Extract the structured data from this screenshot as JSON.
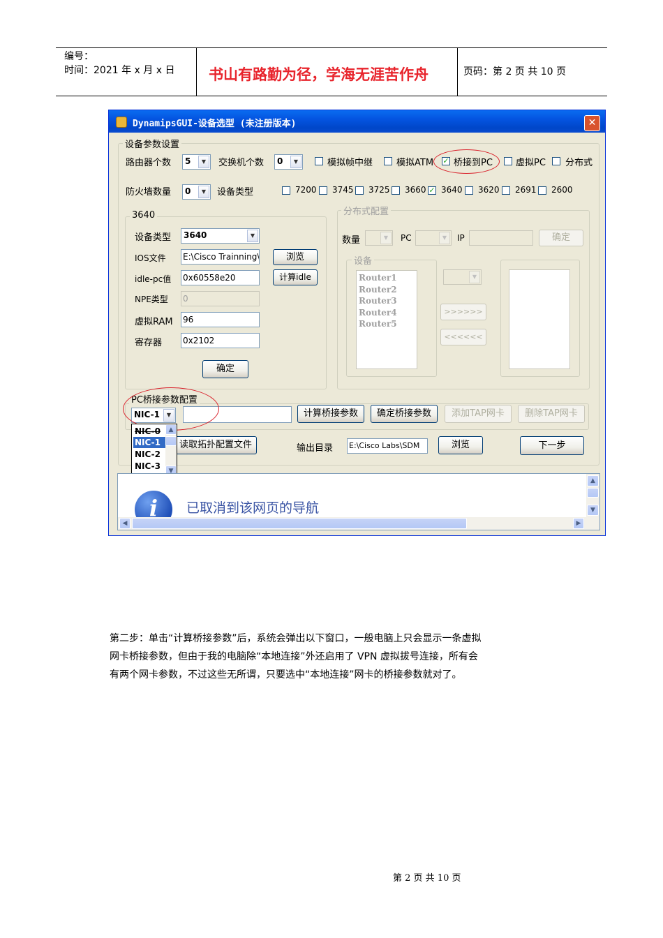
{
  "header": {
    "number_label": "编号：",
    "time_label": "时间：2021 年 x 月 x 日",
    "motto": "书山有路勤为径，学海无涯苦作舟",
    "page_label": "页码：第 2 页  共 10 页"
  },
  "window": {
    "title": "DynamipsGUI-设备选型 (未注册版本)",
    "close_glyph": "✕",
    "device_params": {
      "legend": "设备参数设置",
      "router_count_label": "路由器个数",
      "router_count_value": "5",
      "switch_count_label": "交换机个数",
      "switch_count_value": "0",
      "options": [
        {
          "label": "模拟帧中继",
          "checked": false
        },
        {
          "label": "模拟ATM",
          "checked": false
        },
        {
          "label": "桥接到PC",
          "checked": true
        },
        {
          "label": "虚拟PC",
          "checked": false
        },
        {
          "label": "分布式",
          "checked": false
        }
      ],
      "firewall_count_label": "防火墙数量",
      "firewall_count_value": "0",
      "device_type_label": "设备类型",
      "models": [
        {
          "label": "7200",
          "checked": false
        },
        {
          "label": "3745",
          "checked": false
        },
        {
          "label": "3725",
          "checked": false
        },
        {
          "label": "3660",
          "checked": false
        },
        {
          "label": "3640",
          "checked": true
        },
        {
          "label": "3620",
          "checked": false
        },
        {
          "label": "2691",
          "checked": false
        },
        {
          "label": "2600",
          "checked": false
        }
      ]
    },
    "model_group": {
      "legend": "3640",
      "device_type_label": "设备类型",
      "device_type_value": "3640",
      "ios_label": "IOS文件",
      "ios_value": "E:\\Cisco Trainning\\",
      "browse_label": "浏览",
      "idlepc_label": "idle-pc值",
      "idlepc_value": "0x60558e20",
      "calc_idle_label": "计算idle",
      "npe_label": "NPE类型",
      "npe_value": "0",
      "ram_label": "虚拟RAM",
      "ram_value": "96",
      "register_label": "寄存器",
      "register_value": "0x2102",
      "ok_label": "确定"
    },
    "distributed": {
      "legend": "分布式配置",
      "count_label": "数量",
      "pc_label": "PC",
      "ip_label": "IP",
      "ok_label": "确定",
      "devices_legend": "设备",
      "routers": [
        "Router1",
        "Router2",
        "Router3",
        "Router4",
        "Router5"
      ],
      "add_label": ">>>>>>",
      "remove_label": "<<<<<<"
    },
    "bridge": {
      "legend": "PC桥接参数配置",
      "nic_value": "NIC-1",
      "nic_options": [
        "NIC-0",
        "NIC-1",
        "NIC-2",
        "NIC-3"
      ],
      "nic_selected": "NIC-1",
      "calc_label": "计算桥接参数",
      "confirm_label": "确定桥接参数",
      "add_tap_label": "添加TAP网卡",
      "remove_tap_label": "删除TAP网卡"
    },
    "bottom": {
      "read_topology_label": "读取拓扑配置文件",
      "output_dir_label": "输出目录",
      "output_dir_value": "E:\\Cisco Labs\\SDM",
      "browse_label": "浏览",
      "next_label": "下一步"
    },
    "webpane": {
      "message": "已取消到该网页的导航"
    }
  },
  "body": {
    "lines": [
      "第二步：单击“计算桥接参数”后，系统会弹出以下窗口，一般电脑上只会显示一条虚拟",
      "网卡桥接参数，但由于我的电脑除“本地连接”外还启用了 VPN 虚拟拔号连接，所有会",
      "有两个网卡参数，不过这些无所谓，只要选中“本地连接”网卡的桥接参数就对了。"
    ]
  },
  "footer": {
    "page_text": "第 2 页 共 10 页"
  }
}
